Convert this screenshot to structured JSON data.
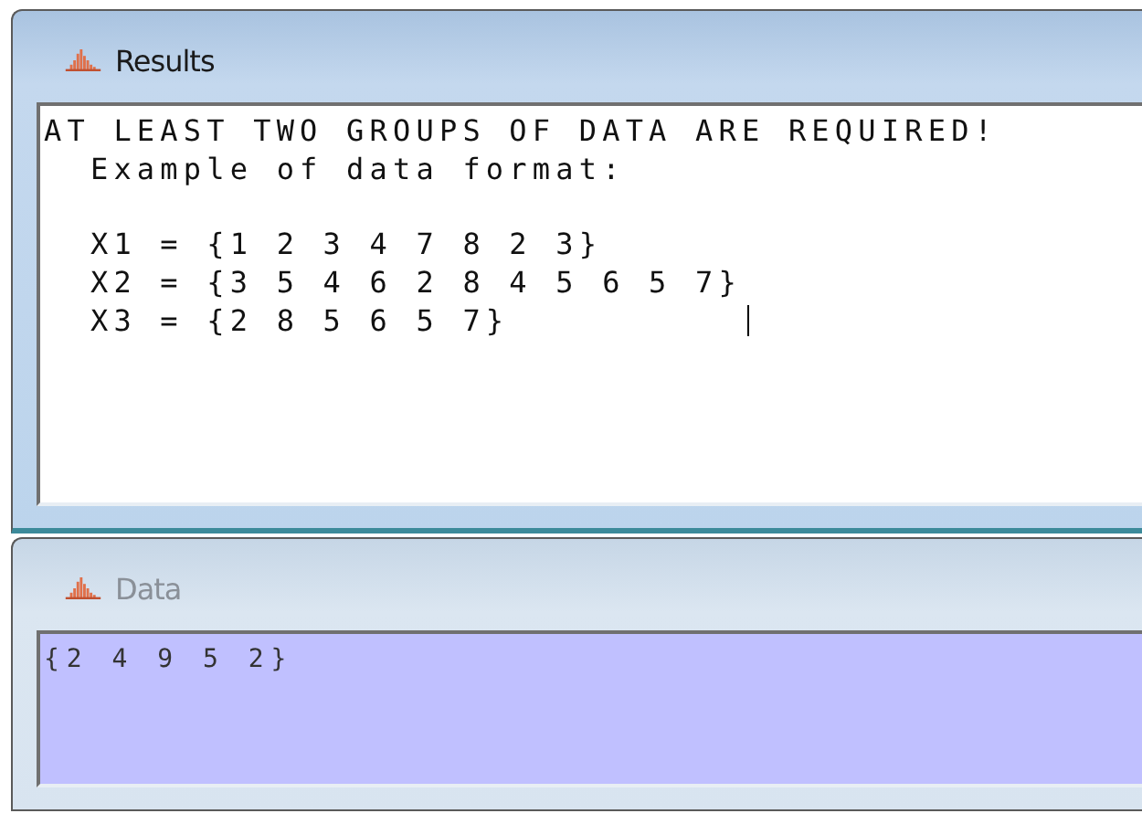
{
  "windows": [
    {
      "title": "Results",
      "active": true,
      "kind": "results",
      "lines": [
        "AT LEAST TWO GROUPS OF DATA ARE REQUIRED!",
        "  Example of data format:"
      ],
      "example_lines": [
        "  X1 = {1 2 3 4 7 8 2 3}",
        "  X2 = {3 5 4 6 2 8 4 5 6 5 7}",
        "  X3 = {2 8 5 6 5 7}"
      ]
    },
    {
      "title": "Data",
      "active": false,
      "kind": "data",
      "lines": [
        "{2 4 9 5 2}"
      ]
    }
  ]
}
